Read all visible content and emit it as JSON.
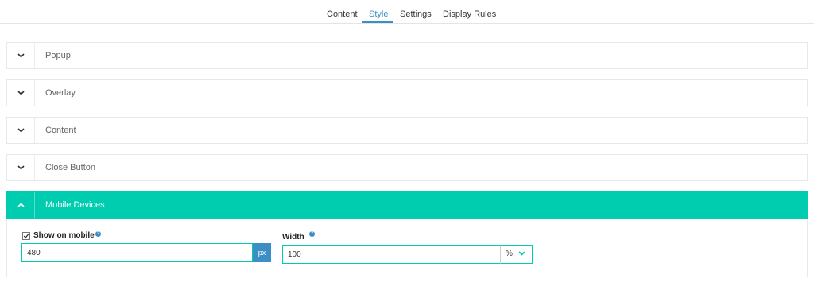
{
  "tabs": [
    {
      "label": "Content",
      "active": false
    },
    {
      "label": "Style",
      "active": true
    },
    {
      "label": "Settings",
      "active": false
    },
    {
      "label": "Display Rules",
      "active": false
    }
  ],
  "panels": [
    {
      "title": "Popup",
      "expanded": false
    },
    {
      "title": "Overlay",
      "expanded": false
    },
    {
      "title": "Content",
      "expanded": false
    },
    {
      "title": "Close Button",
      "expanded": false
    },
    {
      "title": "Mobile Devices",
      "expanded": true
    }
  ],
  "mobile": {
    "show_on_mobile": {
      "label": "Show on mobile",
      "checked": true,
      "value": "480",
      "unit": "px"
    },
    "width": {
      "label": "Width",
      "value": "100",
      "unit": "%"
    }
  },
  "colors": {
    "accent": "#00cdb0",
    "active_tab": "#3b8fc4",
    "unit_button": "#3b8fc4"
  },
  "icons": {
    "collapsed": "chevron-down-icon",
    "expanded": "chevron-up-icon",
    "help": "info-icon",
    "select": "chevron-down-icon"
  }
}
